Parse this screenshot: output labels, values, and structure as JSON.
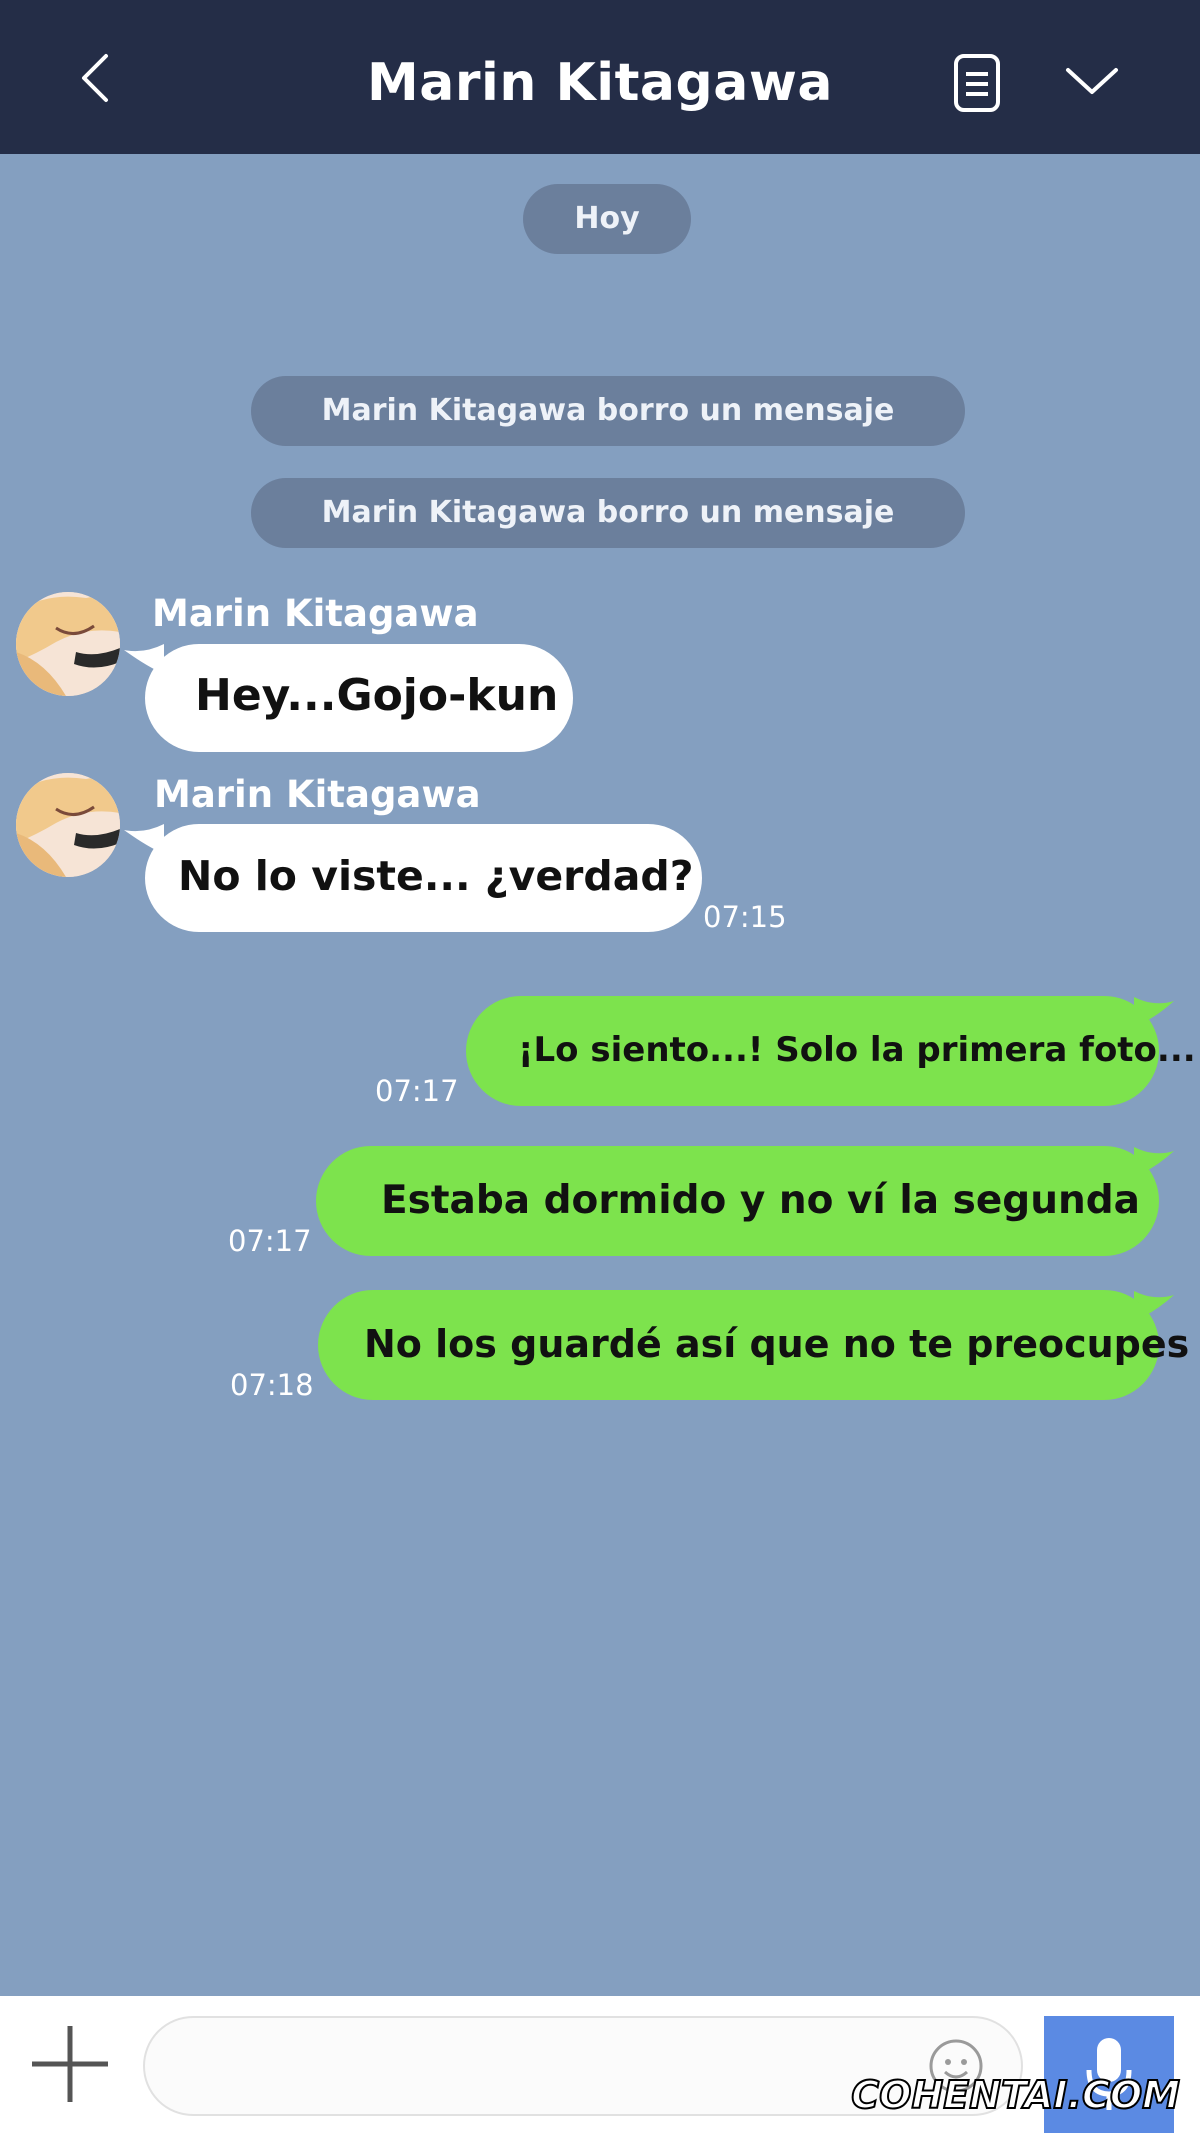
{
  "header": {
    "title": "Marin Kitagawa",
    "back_icon": "chevron-left-icon",
    "notes_icon": "notes-icon",
    "menu_icon": "chevron-down-icon"
  },
  "chat": {
    "date_label": "Hoy",
    "system_messages": [
      "Marin Kitagawa borro un mensaje",
      "Marin Kitagawa borro un mensaje"
    ],
    "incoming": [
      {
        "sender": "Marin Kitagawa",
        "text": "Hey...Gojo-kun",
        "time": ""
      },
      {
        "sender": "Marin Kitagawa",
        "text": "No lo viste... ¿verdad?",
        "time": "07:15"
      }
    ],
    "outgoing": [
      {
        "text": "¡Lo siento...! Solo la primera foto...",
        "time": "07:17"
      },
      {
        "text": "Estaba dormido y no ví la segunda",
        "time": "07:17"
      },
      {
        "text": "No los guardé así que no te preocupes",
        "time": "07:18"
      }
    ]
  },
  "composer": {
    "value": "",
    "plus_icon": "plus-icon",
    "emoji_icon": "emoji-icon",
    "mic_icon": "microphone-icon"
  },
  "watermark": "COHENTAI.COM",
  "colors": {
    "header": "#242d47",
    "background": "#849fc0",
    "system_pill": "#6b7f9c",
    "incoming_bubble": "#ffffff",
    "outgoing_bubble": "#7de34d",
    "mic_button": "#5b8ae3"
  }
}
